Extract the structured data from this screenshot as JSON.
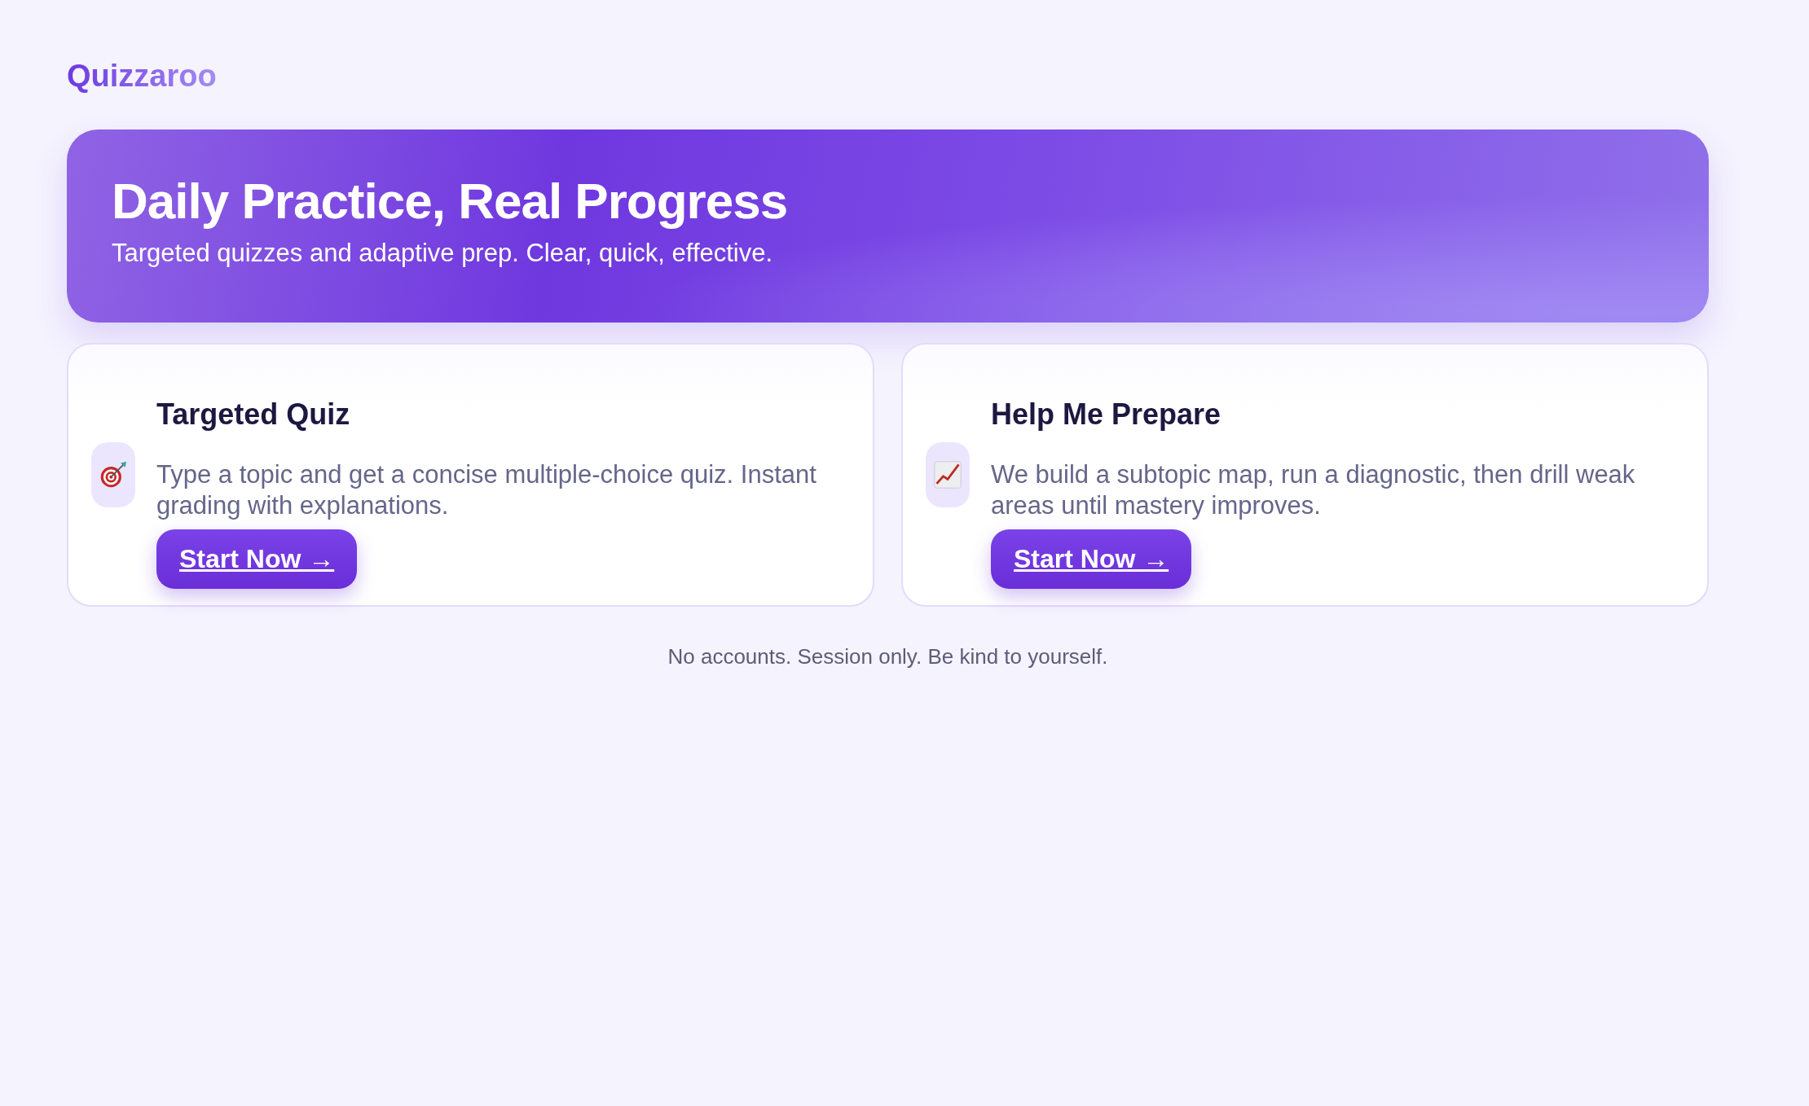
{
  "brand": "Quizzaroo",
  "hero": {
    "title": "Daily Practice, Real Progress",
    "subtitle": "Targeted quizzes and adaptive prep. Clear, quick, effective."
  },
  "cards": [
    {
      "kind": "target",
      "title": "Targeted Quiz",
      "description": "Type a topic and get a concise multiple-choice quiz. Instant grading with explanations.",
      "button": "Start Now →"
    },
    {
      "kind": "chart",
      "title": "Help Me Prepare",
      "description": "We build a subtopic map, run a diagnostic, then drill weak areas until mastery improves.",
      "button": "Start Now →"
    }
  ],
  "footer": "No accounts. Session only. Be kind to yourself."
}
